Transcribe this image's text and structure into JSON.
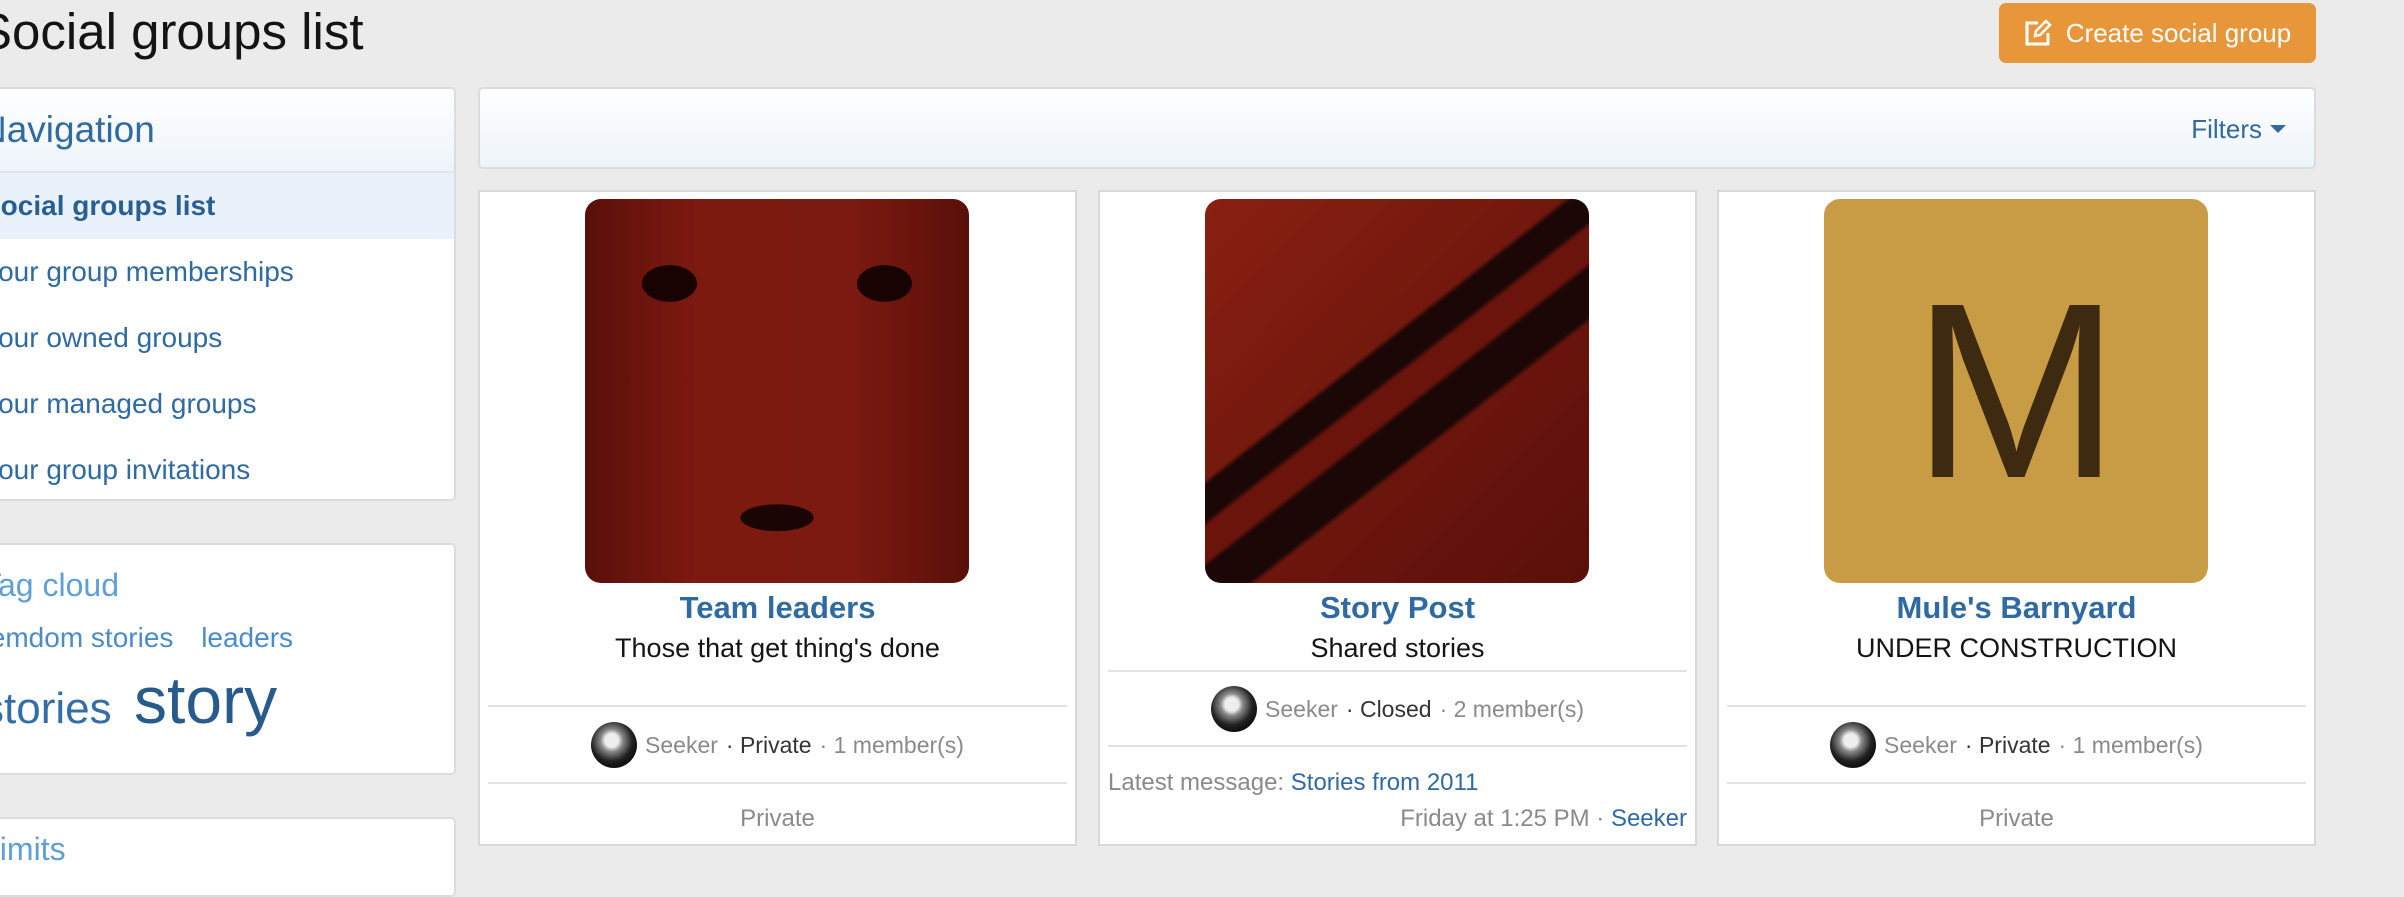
{
  "page": {
    "title": "Social groups list"
  },
  "header": {
    "create_button": "Create social group",
    "create_icon": "edit-icon"
  },
  "navigation": {
    "title": "Navigation",
    "items": [
      {
        "label": "Social groups list",
        "active": true
      },
      {
        "label": "Your group memberships"
      },
      {
        "label": "Your owned groups"
      },
      {
        "label": "Your managed groups"
      },
      {
        "label": "Your group invitations"
      }
    ]
  },
  "tag_cloud": {
    "title": "Tag cloud",
    "tags": [
      "femdom stories",
      "leaders",
      "stories",
      "story"
    ]
  },
  "limits": {
    "title": "Limits"
  },
  "filters": {
    "label": "Filters"
  },
  "colors": {
    "accent": "#2f6aa0",
    "button": "#e8963a",
    "background": "#ebebeb"
  },
  "groups": [
    {
      "name": "Team leaders",
      "description": "Those that get thing's done",
      "owner": "Seeker",
      "privacy": "Private",
      "members": "1 member(s)",
      "footer": "Private"
    },
    {
      "name": "Story Post",
      "description": "Shared stories",
      "owner": "Seeker",
      "privacy": "Closed",
      "members": "2 member(s)",
      "latest_label": "Latest message:",
      "latest_title": "Stories from 2011",
      "latest_time": "Friday at 1:25 PM",
      "latest_author": "Seeker"
    },
    {
      "name": "Mule's Barnyard",
      "description": "UNDER CONSTRUCTION",
      "owner": "Seeker",
      "privacy": "Private",
      "members": "1 member(s)",
      "footer": "Private",
      "letter": "M"
    }
  ]
}
